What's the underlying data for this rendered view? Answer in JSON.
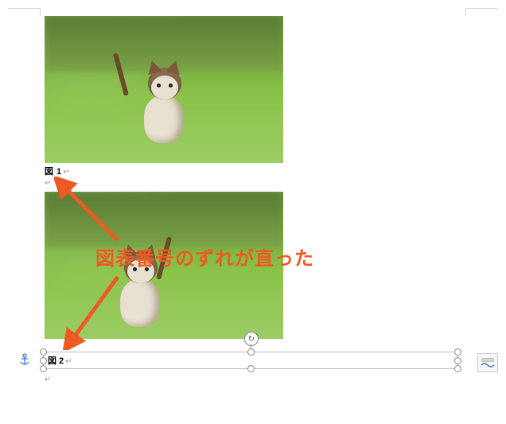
{
  "captions": {
    "fig1": "図 1",
    "fig2": "図 2"
  },
  "paragraph_mark": "↵",
  "annotation": {
    "text": "図表番号のずれが直った"
  },
  "icons": {
    "anchor": "anchor-icon",
    "layout_options": "layout-options-icon",
    "rotate": "rotate-handle-icon"
  }
}
